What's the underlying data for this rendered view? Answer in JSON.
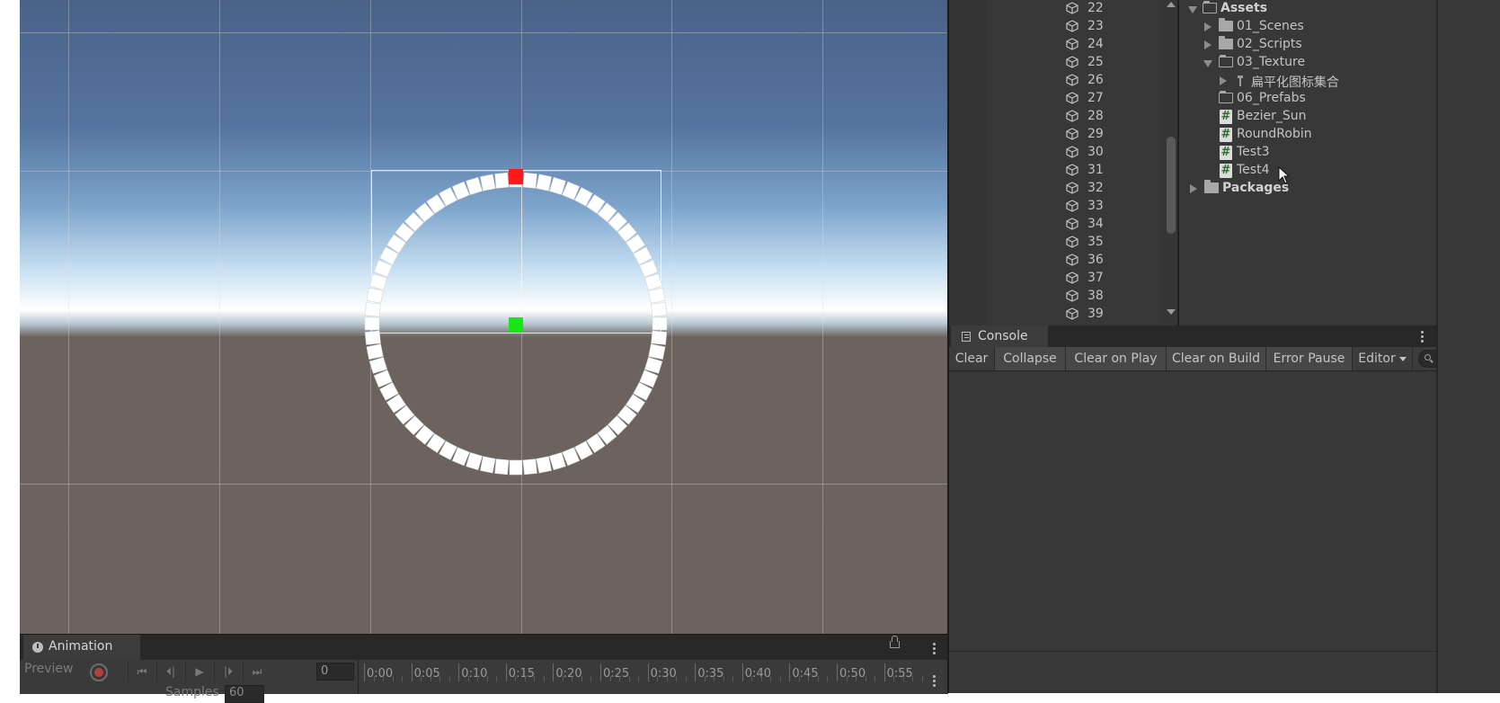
{
  "hierarchy": {
    "items": [
      "22",
      "23",
      "24",
      "25",
      "26",
      "27",
      "28",
      "29",
      "30",
      "31",
      "32",
      "33",
      "34",
      "35",
      "36",
      "37",
      "38",
      "39"
    ]
  },
  "project": {
    "root_label": "Assets",
    "items": [
      {
        "label": "01_Scenes"
      },
      {
        "label": "02_Scripts"
      },
      {
        "label": "03_Texture"
      },
      {
        "label": "扁平化图标集合"
      },
      {
        "label": "06_Prefabs"
      },
      {
        "label": "Bezier_Sun"
      },
      {
        "label": "RoundRobin"
      },
      {
        "label": "Test3"
      },
      {
        "label": "Test4"
      }
    ],
    "packages_label": "Packages"
  },
  "console": {
    "tab_label": "Console",
    "buttons": {
      "clear": "Clear",
      "collapse": "Collapse",
      "clear_on_play": "Clear on Play",
      "clear_on_build": "Clear on Build",
      "error_pause": "Error Pause",
      "editor": "Editor"
    }
  },
  "animation": {
    "tab_label": "Animation",
    "preview_label": "Preview",
    "frame_value": "0",
    "samples_label": "Samples",
    "samples_value": "60",
    "time_ticks": [
      "0:00",
      "0:05",
      "0:10",
      "0:15",
      "0:20",
      "0:25",
      "0:30",
      "0:35",
      "0:40",
      "0:45",
      "0:50",
      "0:55"
    ]
  },
  "icons": {
    "scene_object": "cube-icon",
    "folder": "folder-icon",
    "script": "script-icon",
    "record": "record-icon",
    "lock": "lock-icon",
    "search": "search-icon",
    "menu": "kebab-menu-icon"
  },
  "colors": {
    "selection_handle": "#ff1a1a",
    "pivot_handle": "#19e619",
    "panel_bg": "#383838",
    "record": "#b0413e"
  }
}
